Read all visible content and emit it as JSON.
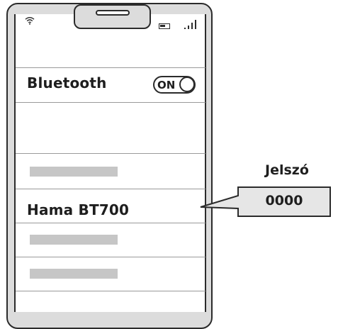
{
  "status_bar": {
    "wifi_icon": "wifi-icon",
    "battery_icon": "battery-icon",
    "signal_icon": "cellular-signal-icon"
  },
  "bluetooth": {
    "label": "Bluetooth",
    "toggle_state": "ON"
  },
  "device_list": {
    "selected_device": "Hama BT700"
  },
  "password_callout": {
    "title": "Jelszó",
    "value": "0000"
  },
  "colors": {
    "outline": "#2b2b2b",
    "frame": "#dcdcdc",
    "placeholder": "#c6c6c6",
    "callout_fill": "#e6e6e6"
  }
}
